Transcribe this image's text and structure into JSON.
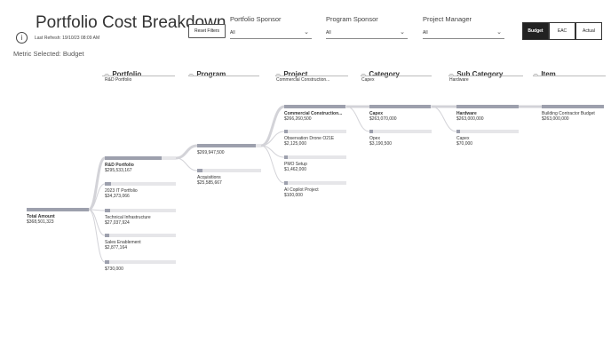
{
  "header": {
    "title": "Portfolio Cost Breakdown",
    "last_refresh": "Last Refresh: 19/10/23 08:09 AM",
    "info_glyph": "i",
    "reset_label": "Reset Filters"
  },
  "filters": [
    {
      "label": "Portfolio Sponsor",
      "value": "All"
    },
    {
      "label": "Program Sponsor",
      "value": "All"
    },
    {
      "label": "Project Manager",
      "value": "All"
    }
  ],
  "metric_buttons": {
    "budget": "Budget",
    "eac": "EAC",
    "actual": "Actual",
    "selected": "Budget"
  },
  "metric_selected": "Metric Selected: Budget",
  "columns": [
    {
      "title": "Portfolio",
      "selected": "R&D Portfolio"
    },
    {
      "title": "Program",
      "selected": ""
    },
    {
      "title": "Project",
      "selected": "Commercial Construction..."
    },
    {
      "title": "Category",
      "selected": "Capex"
    },
    {
      "title": "Sub Category",
      "selected": "Hardware"
    },
    {
      "title": "Item",
      "selected": ""
    }
  ],
  "tree": {
    "root": {
      "label": "Total Amount",
      "value": "$368,501,323"
    },
    "portfolio": [
      {
        "label": "R&D Portfolio",
        "value": "$295,533,167",
        "frac": 0.8,
        "bold": true
      },
      {
        "label": "2023 IT Portfolio",
        "value": "$34,373,066",
        "frac": 0.09
      },
      {
        "label": "Technical Infrastructure",
        "value": "$27,037,924",
        "frac": 0.07
      },
      {
        "label": "Sales Enablement",
        "value": "$2,877,164",
        "frac": 0.01
      },
      {
        "label": "",
        "value": "$730,000",
        "frac": 0.005
      }
    ],
    "program": [
      {
        "label": "",
        "value": "$269,947,500",
        "frac": 0.91
      },
      {
        "label": "Acquisitions",
        "value": "$25,585,667",
        "frac": 0.09
      }
    ],
    "project": [
      {
        "label": "Commercial Construction...",
        "value": "$266,260,500",
        "frac": 0.99,
        "bold": true
      },
      {
        "label": "Observation Drone O21E",
        "value": "$2,125,000",
        "frac": 0.01
      },
      {
        "label": "PMO Setup",
        "value": "$1,462,000",
        "frac": 0.005
      },
      {
        "label": "AI Copilot Project",
        "value": "$100,000",
        "frac": 0.001
      }
    ],
    "category": [
      {
        "label": "Capex",
        "value": "$263,070,000",
        "frac": 0.99,
        "bold": true
      },
      {
        "label": "Opex",
        "value": "$3,190,500",
        "frac": 0.012
      }
    ],
    "subcategory": [
      {
        "label": "Hardware",
        "value": "$263,000,000",
        "frac": 0.999,
        "bold": true
      },
      {
        "label": "Capex",
        "value": "$70,000",
        "frac": 0.001
      }
    ],
    "item": [
      {
        "label": "Building Contractor Budget",
        "value": "$263,000,000",
        "frac": 1.0
      }
    ]
  },
  "colors": {
    "bar_fill": "#9da0ad",
    "bar_bg": "#e6e6e9",
    "link": "#d3d3d8",
    "dark_button": "#222222"
  }
}
